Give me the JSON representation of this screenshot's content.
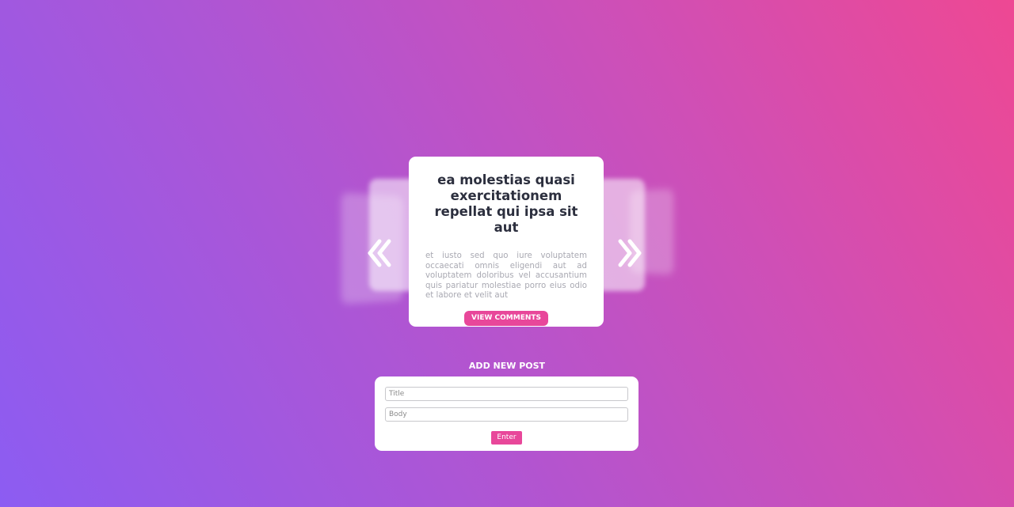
{
  "carousel": {
    "current_post": {
      "title": "ea molestias quasi exercitationem repellat qui ipsa sit aut",
      "body": "et iusto sed quo iure voluptatem occaecati omnis eligendi aut ad voluptatem doloribus vel accusantium quis pariatur molestiae porro eius odio et labore et velit aut",
      "button_label": "VIEW COMMENTS"
    },
    "prev_icon": "chevron-left-icon",
    "next_icon": "chevron-right-icon"
  },
  "new_post_form": {
    "heading": "ADD NEW POST",
    "title_placeholder": "Title",
    "body_placeholder": "Body",
    "submit_label": "Enter"
  },
  "colors": {
    "accent": "#e8479a",
    "gradient_start": "#8c5cf2",
    "gradient_end": "#ee4893",
    "title_text": "#2c2f3e",
    "body_text": "#a9a9b2"
  }
}
